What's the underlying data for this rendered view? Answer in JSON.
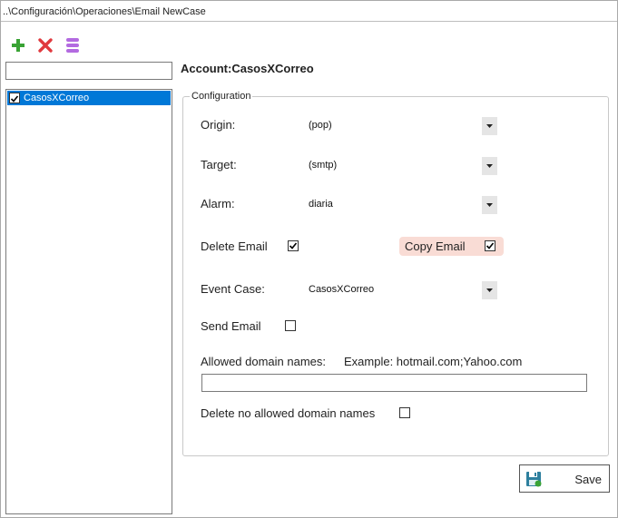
{
  "window": {
    "title": "..\\Configuración\\Operaciones\\Email NewCase"
  },
  "toolbar": {
    "add_icon": "plus-icon",
    "delete_icon": "x-icon",
    "database_icon": "database-icon"
  },
  "left_panel": {
    "search_value": "",
    "tree_items": [
      {
        "label": "CasosXCorreo",
        "checked": true,
        "selected": true
      }
    ]
  },
  "account": {
    "title": "Account:CasosXCorreo"
  },
  "configuration": {
    "legend": "Configuration",
    "origin": {
      "label": "Origin:",
      "value": "(pop)"
    },
    "target": {
      "label": "Target:",
      "value": "(smtp)"
    },
    "alarm": {
      "label": "Alarm:",
      "value": "diaria"
    },
    "delete_email": {
      "label": "Delete Email",
      "checked": true
    },
    "copy_email": {
      "label": "Copy Email",
      "checked": true,
      "highlight_color": "#f9dcd5"
    },
    "event_case": {
      "label": "Event Case:",
      "value": "CasosXCorreo"
    },
    "send_email": {
      "label": "Send Email",
      "checked": false
    },
    "allowed_domains": {
      "label": "Allowed domain names:",
      "example": "Example: hotmail.com;Yahoo.com",
      "value": ""
    },
    "delete_no_allowed": {
      "label": "Delete no allowed domain names",
      "checked": false
    }
  },
  "save_button": {
    "label": "Save",
    "icon": "floppy-disk-icon"
  },
  "colors": {
    "selection": "#0078d7",
    "add": "#3aa335",
    "delete": "#e0393e",
    "database": "#b36ae0"
  }
}
